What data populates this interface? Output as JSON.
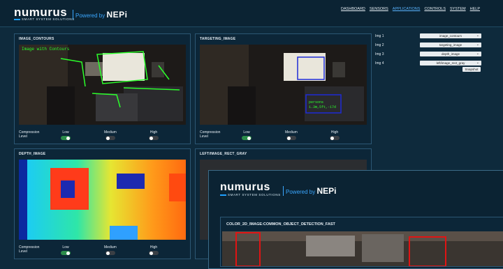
{
  "header": {
    "logo": "numurus",
    "logo_sub": "SMART SYSTEM SOLUTIONS",
    "powered_by": "Powered by",
    "powered_brand": "NEPi",
    "nav": [
      "DASHBOARD",
      "SENSORS",
      "APPLICATIONS",
      "CONTROLS",
      "SYSTEM",
      "HELP"
    ],
    "active_nav": "APPLICATIONS"
  },
  "panels": [
    {
      "title": "IMAGE_CONTOURS",
      "overlay_text": "Image with Contours",
      "compression_label": "Compression",
      "level_label": "Level",
      "options": [
        "Low",
        "Medium",
        "High"
      ],
      "selected": "Low"
    },
    {
      "title": "TARGETING_IMAGE",
      "target_text": [
        "persons",
        "1.3m,5ft,-17d"
      ],
      "compression_label": "Compression",
      "level_label": "Level",
      "options": [
        "Low",
        "Medium",
        "High"
      ],
      "selected": "Low"
    },
    {
      "title": "DEPTH_IMAGE",
      "compression_label": "Compression",
      "level_label": "Level",
      "options": [
        "Low",
        "Medium",
        "High"
      ],
      "selected": "Low"
    },
    {
      "title": "LEFT/IMAGE_RECT_GRAY"
    }
  ],
  "image_selectors": [
    {
      "label": "Img 1",
      "value": "image_contours"
    },
    {
      "label": "Img 2",
      "value": "targeting_image"
    },
    {
      "label": "Img 3",
      "value": "depth_image"
    },
    {
      "label": "Img 4",
      "value": "left/image_rect_gray"
    }
  ],
  "snapshot_label": "Snapshot",
  "overlay_window": {
    "logo": "numurus",
    "logo_sub": "SMART SYSTEM SOLUTIONS",
    "powered_by": "Powered by",
    "powered_brand": "NEPi",
    "panel_title": "COLOR_2D_IMAGE:COMMON_OBJECT_DETECTION_FAST"
  },
  "colors": {
    "accent": "#3aa7ff",
    "toggle_on": "#2c8c4a",
    "panel_bg": "#0c2638",
    "contour": "#2bff2b",
    "box": "#1e2bd6",
    "detect": "#e01414"
  }
}
